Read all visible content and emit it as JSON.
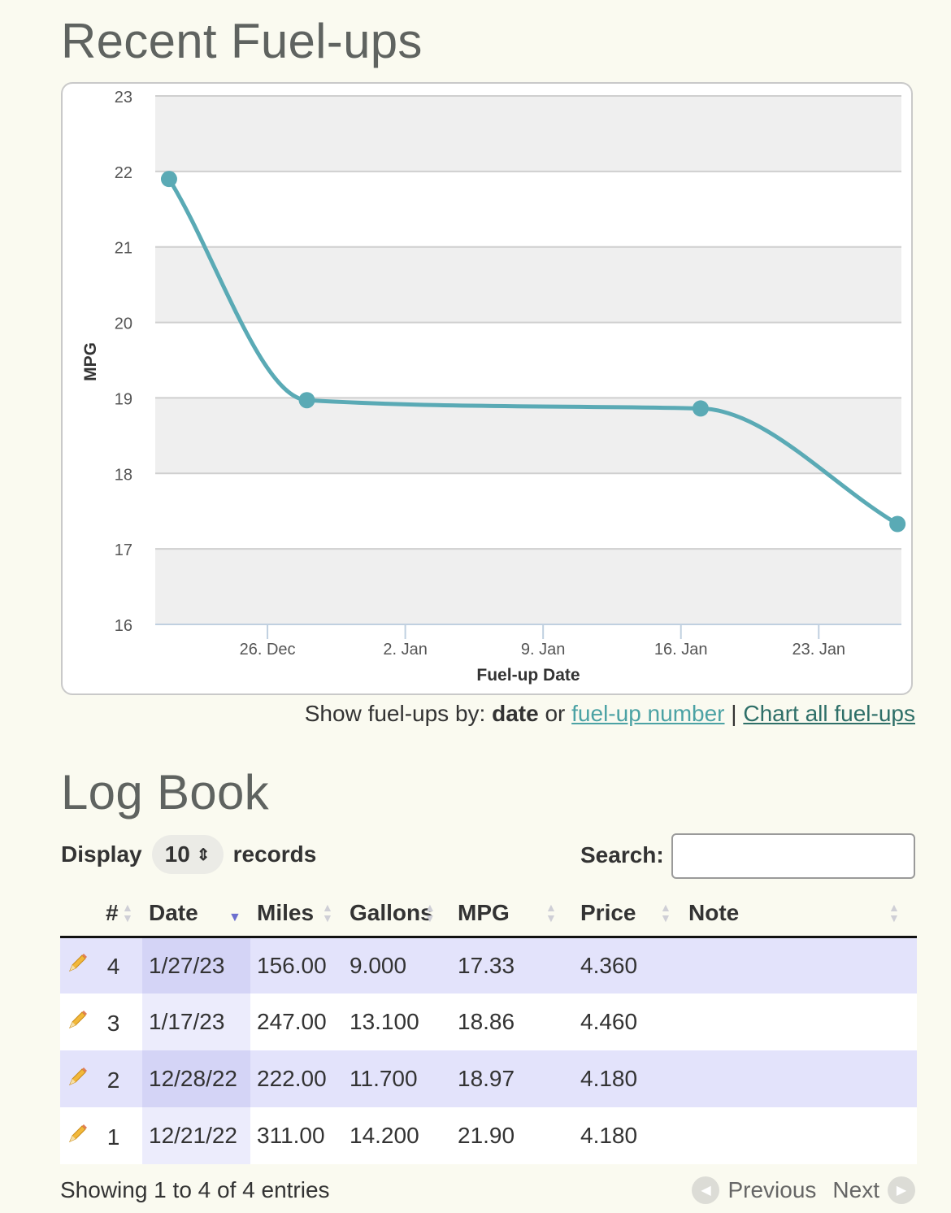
{
  "titles": {
    "recent": "Recent Fuel-ups",
    "logbook": "Log Book"
  },
  "chart_data": {
    "type": "line",
    "x": [
      "2022-12-21",
      "2022-12-28",
      "2023-01-17",
      "2023-01-27"
    ],
    "series": [
      {
        "values": [
          21.9,
          18.97,
          18.86,
          17.33
        ]
      }
    ],
    "x_ticks": [
      "26. Dec",
      "2. Jan",
      "9. Jan",
      "16. Jan",
      "23. Jan"
    ],
    "x_tick_dates": [
      "2022-12-26",
      "2023-01-02",
      "2023-01-09",
      "2023-01-16",
      "2023-01-23"
    ],
    "y_ticks": [
      "16",
      "17",
      "18",
      "19",
      "20",
      "21",
      "22",
      "23"
    ],
    "ylim": [
      16,
      23
    ],
    "xlabel": "Fuel-up Date",
    "ylabel": "MPG",
    "grid": true,
    "color": "#5aaab5"
  },
  "chart_links": {
    "prefix": "Show fuel-ups by:",
    "current": "date",
    "or": "or",
    "alt_link": "fuel-up number",
    "separator": "|",
    "all_link": "Chart all fuel-ups"
  },
  "controls": {
    "display_label": "Display",
    "length_value": "10",
    "records_label": "records",
    "search_label": "Search:",
    "search_value": ""
  },
  "table": {
    "headers": [
      "#",
      "Date",
      "Miles",
      "Gallons",
      "MPG",
      "Price",
      "Note"
    ],
    "rows": [
      [
        "4",
        "1/27/23",
        "156.00",
        "9.000",
        "17.33",
        "4.360",
        ""
      ],
      [
        "3",
        "1/17/23",
        "247.00",
        "13.100",
        "18.86",
        "4.460",
        ""
      ],
      [
        "2",
        "12/28/22",
        "222.00",
        "11.700",
        "18.97",
        "4.180",
        ""
      ],
      [
        "1",
        "12/21/22",
        "311.00",
        "14.200",
        "21.90",
        "4.180",
        ""
      ]
    ],
    "edit_icon": "pencil-icon",
    "sorted_column": "Date"
  },
  "footer": {
    "info": "Showing 1 to 4 of 4 entries",
    "previous": "Previous",
    "next": "Next"
  }
}
